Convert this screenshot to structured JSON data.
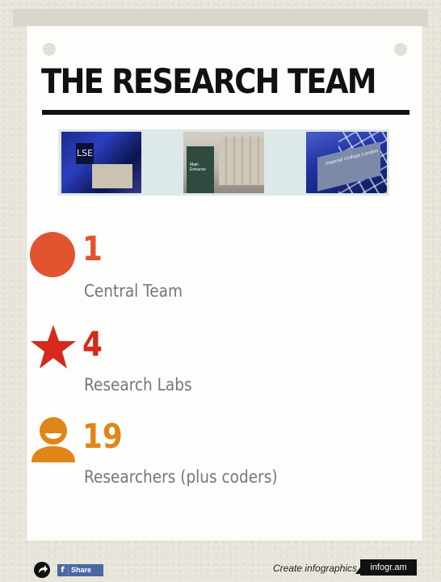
{
  "title": "THE RESEARCH TEAM",
  "photos": {
    "lse_sign": "LSE",
    "kings_sign": "Main Entrance",
    "imperial_sign": "Imperial College London"
  },
  "stats": [
    {
      "number": "1",
      "label": "Central Team",
      "icon": "circle-icon",
      "color": "#e2542f"
    },
    {
      "number": "4",
      "label": "Research Labs",
      "icon": "star-icon",
      "color": "#d7281d"
    },
    {
      "number": "19",
      "label": "Researchers (plus coders)",
      "icon": "person-icon",
      "color": "#e08618"
    }
  ],
  "footer": {
    "share_label": "Share",
    "create_label": "Create infographics",
    "brand_label": "infogr.am"
  }
}
